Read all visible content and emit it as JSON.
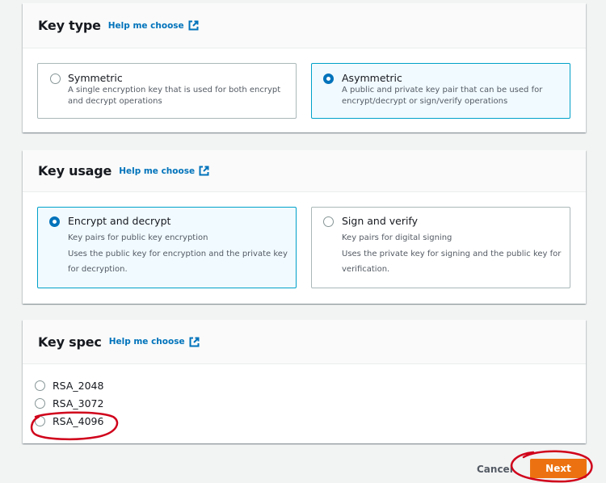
{
  "key_type": {
    "title": "Key type",
    "help_link": "Help me choose",
    "options": [
      {
        "label": "Symmetric",
        "description": "A single encryption key that is used for both encrypt and decrypt operations",
        "selected": false
      },
      {
        "label": "Asymmetric",
        "description": "A public and private key pair that can be used for encrypt/decrypt or sign/verify operations",
        "selected": true
      }
    ]
  },
  "key_usage": {
    "title": "Key usage",
    "help_link": "Help me choose",
    "options": [
      {
        "label": "Encrypt and decrypt",
        "subtitle": "Key pairs for public key encryption",
        "description": "Uses the public key for encryption and the private key for decryption.",
        "selected": true
      },
      {
        "label": "Sign and verify",
        "subtitle": "Key pairs for digital signing",
        "description": "Uses the private key for signing and the public key for verification.",
        "selected": false
      }
    ]
  },
  "key_spec": {
    "title": "Key spec",
    "help_link": "Help me choose",
    "options": [
      {
        "label": "RSA_2048",
        "selected": false
      },
      {
        "label": "RSA_3072",
        "selected": false
      },
      {
        "label": "RSA_4096",
        "selected": false
      }
    ]
  },
  "footer": {
    "cancel_label": "Cancel",
    "next_label": "Next"
  },
  "colors": {
    "accent": "#0073bb",
    "selected_border": "#00a1c9",
    "primary_button": "#ec7211",
    "annotation": "#d0021b"
  }
}
